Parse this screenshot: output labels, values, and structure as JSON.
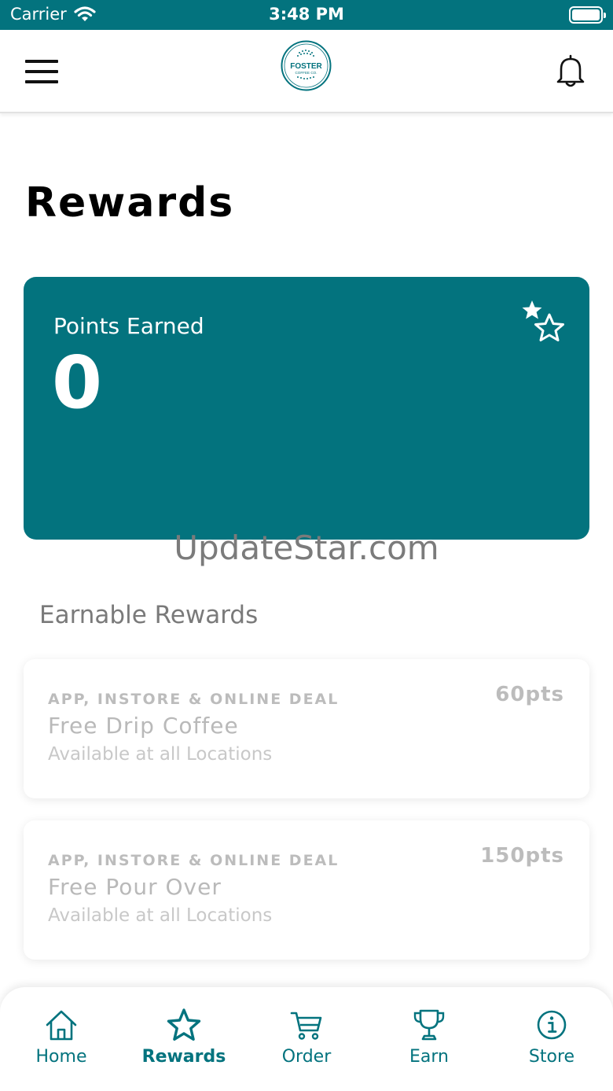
{
  "status_bar": {
    "carrier": "Carrier",
    "time": "3:48 PM"
  },
  "header": {
    "logo_text": "FOSTER",
    "logo_subtext": "COFFEE CO."
  },
  "page": {
    "title": "Rewards"
  },
  "points_card": {
    "label": "Points Earned",
    "value": "0"
  },
  "watermark": "UpdateStar.com",
  "earnable": {
    "title": "Earnable Rewards",
    "items": [
      {
        "deal": "APP, INSTORE & ONLINE DEAL",
        "name": "Free Drip Coffee",
        "availability": "Available at all Locations",
        "points": "60pts"
      },
      {
        "deal": "APP, INSTORE & ONLINE DEAL",
        "name": "Free Pour Over",
        "availability": "Available at all Locations",
        "points": "150pts"
      }
    ]
  },
  "tabs": [
    {
      "label": "Home",
      "icon": "home-icon",
      "active": false
    },
    {
      "label": "Rewards",
      "icon": "star-icon",
      "active": true
    },
    {
      "label": "Order",
      "icon": "cart-icon",
      "active": false
    },
    {
      "label": "Earn",
      "icon": "trophy-icon",
      "active": false
    },
    {
      "label": "Store",
      "icon": "info-icon",
      "active": false
    }
  ],
  "colors": {
    "brand": "#03737e",
    "muted_text": "#bcbcbc",
    "background": "#ffffff"
  }
}
